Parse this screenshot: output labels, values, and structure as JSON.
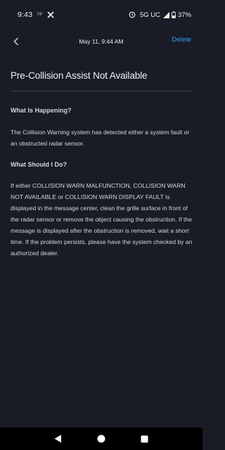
{
  "status_bar": {
    "time": "9:43",
    "temperature": "74°",
    "network": "5G UC",
    "battery": "37%"
  },
  "header": {
    "date": "May 11, 9:44 AM",
    "delete_label": "Delete"
  },
  "message": {
    "title": "Pre-Collision Assist Not Available",
    "what_heading": "What Is Happening?",
    "what_text": "The Collision Warning system has detected either a system fault or an obstructed radar sensor.",
    "todo_heading": "What Should I Do?",
    "todo_text": "If either COLLISION WARN MALFUNCTION, COLLISION WARN NOT AVAILABLE or COLLISION WARN DISPLAY FAULT is displayed in the message center, clean the grille surface in front of the radar sensor or remove the object causing the obstruction. If the message is displayed after the obstruction is removed, wait a short time. If the problem persists, please have the system checked by an authorized dealer."
  },
  "colors": {
    "background": "#191b26",
    "accent": "#3a9fe6",
    "divider": "#3a3d4b"
  },
  "icons": [
    "x-logo-icon",
    "alarm-icon",
    "signal-icon",
    "battery-icon",
    "chevron-left-icon",
    "back-triangle-icon",
    "home-circle-icon",
    "recents-square-icon"
  ]
}
